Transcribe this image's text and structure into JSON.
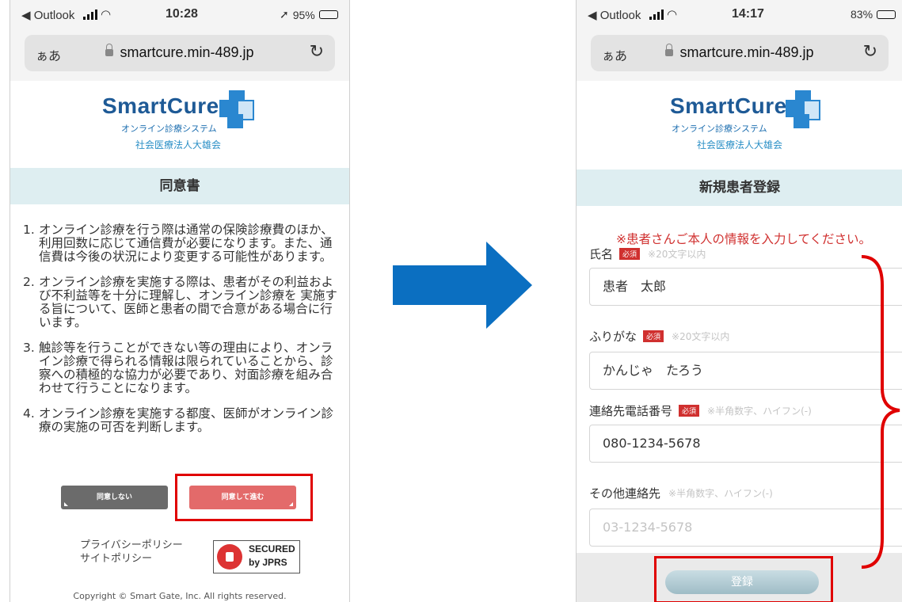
{
  "left_phone": {
    "status": {
      "back": "◀ Outlook",
      "time": "10:28",
      "battery": "95%",
      "battery_level": 0.95
    },
    "url": {
      "aa": "ぁあ",
      "domain": "smartcure.min-489.jp"
    },
    "logo": {
      "word": "SmartCure",
      "sub": "オンライン診療システム",
      "org": "社会医療法人大雄会"
    },
    "section_title": "同意書",
    "terms": [
      {
        "num": "1.",
        "text": "オンライン診療を行う際は通常の保険診療費のほか、利用回数に応じて通信費が必要になります。また、通信費は今後の状況により変更する可能性があります。"
      },
      {
        "num": "2.",
        "text": "オンライン診療を実施する際は、患者がその利益および不利益等を十分に理解し、オンライン診療を 実施する旨について、医師と患者の間で合意がある場合に行います。"
      },
      {
        "num": "3.",
        "text": "触診等を行うことができない等の理由により、オンライン診療で得られる情報は限られていることから、診察への積極的な協力が必要であり、対面診療を組み合わせて行うことになります。"
      },
      {
        "num": "4.",
        "text": "オンライン診療を実施する都度、医師がオンライン診療の実施の可否を判断します。"
      }
    ],
    "buttons": {
      "disagree": "同意しない",
      "agree": "同意して進む"
    },
    "policies": [
      "プライバシーポリシー",
      "サイトポリシー"
    ],
    "badge": {
      "line1": "SECURED",
      "line2": "by JPRS"
    },
    "copyright": "Copyright © Smart Gate, Inc. All rights reserved."
  },
  "right_phone": {
    "status": {
      "back": "◀ Outlook",
      "time": "14:17",
      "battery": "83%",
      "battery_level": 0.83
    },
    "url": {
      "aa": "ぁあ",
      "domain": "smartcure.min-489.jp"
    },
    "logo": {
      "word": "SmartCure",
      "sub": "オンライン診療システム",
      "org": "社会医療法人大雄会"
    },
    "section_title": "新規患者登録",
    "notice": "※患者さんご本人の情報を入力してください。",
    "fields": [
      {
        "label": "氏名",
        "required": "必須",
        "hint": "※20文字以内",
        "value": "患者　太郎",
        "placeholder": ""
      },
      {
        "label": "ふりがな",
        "required": "必須",
        "hint": "※20文字以内",
        "value": "かんじゃ　たろう",
        "placeholder": ""
      },
      {
        "label": "連絡先電話番号",
        "required": "必須",
        "hint": "※半角数字、ハイフン(-)",
        "value": "080-1234-5678",
        "placeholder": ""
      },
      {
        "label": "その他連絡先",
        "required": "",
        "hint": "※半角数字、ハイフン(-)",
        "value": "",
        "placeholder": "03-1234-5678"
      }
    ],
    "submit": "登録"
  },
  "colors": {
    "highlight": "#e00000",
    "arrow": "#0b6fc1",
    "section_bg": "#deeef1",
    "agree_btn": "#e36a6a",
    "required": "#d0302f"
  }
}
